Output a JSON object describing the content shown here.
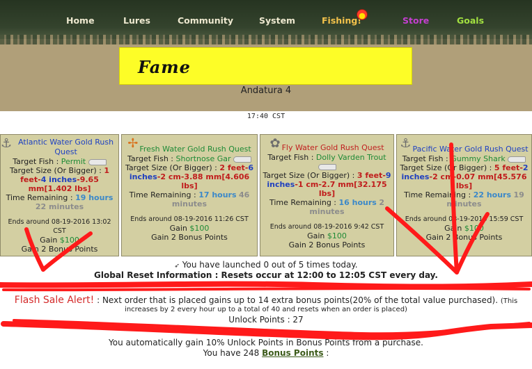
{
  "nav": {
    "home": "Home",
    "lures": "Lures",
    "community": "Community",
    "system": "System",
    "fishing": "Fishing!",
    "store": "Store",
    "goals": "Goals"
  },
  "banner": {
    "title": "Fame",
    "player": "Andatura 4"
  },
  "clock": "17:40 CST",
  "quests": [
    {
      "title": "Atlantic Water Gold Rush Quest",
      "fish_label": "Target Fish : ",
      "fish": "Permit",
      "size_label": "Target Size (Or Bigger) : ",
      "size_p1": "1 feet",
      "size_p2": "-",
      "size_p3": "4 inches",
      "size_p4": "-",
      "size_p5": "9.65 mm",
      "size_p6": "[1.402 lbs]",
      "time_label": "Time Remaining : ",
      "time_value": "19 hours",
      "time_extra": "22 minutes",
      "ends": "Ends around 08-19-2016 13:02 CST",
      "gain_label": "Gain ",
      "gain_value": "$100",
      "bonus": "Gain 2 Bonus Points"
    },
    {
      "title": "Fresh Water Gold Rush Quest",
      "fish_label": "Target Fish : ",
      "fish": "Shortnose Gar",
      "size_label": "Target Size (Or Bigger) : ",
      "size_p1": "2 feet",
      "size_p2": "-",
      "size_p3": "6 inches",
      "size_p4": "-",
      "size_p5": "2 cm-3.88 mm",
      "size_p6": "[4.606 lbs]",
      "time_label": "Time Remaining : ",
      "time_value": "17 hours",
      "time_extra": "46 minutes",
      "ends": "Ends around 08-19-2016 11:26 CST",
      "gain_label": "Gain ",
      "gain_value": "$100",
      "bonus": "Gain 2 Bonus Points"
    },
    {
      "title": "Fly Water Gold Rush Quest",
      "fish_label": "Target Fish : ",
      "fish": "Dolly Varden Trout",
      "size_label": "Target Size (Or Bigger) : ",
      "size_p1": "3 feet",
      "size_p2": "-",
      "size_p3": "9 inches",
      "size_p4": "-",
      "size_p5": "1 cm-2.7 mm",
      "size_p6": "[32.175 lbs]",
      "time_label": "Time Remaining : ",
      "time_value": "16 hours",
      "time_extra": "2 minutes",
      "ends": "Ends around 08-19-2016 9:42 CST",
      "gain_label": "Gain ",
      "gain_value": "$100",
      "bonus": "Gain 2 Bonus Points"
    },
    {
      "title": "Pacific Water Gold Rush Quest",
      "fish_label": "Target Fish : ",
      "fish": "Gummy Shark",
      "size_label": "Target Size (Or Bigger) : ",
      "size_p1": "5 feet",
      "size_p2": "-",
      "size_p3": "2 inches",
      "size_p4": "-",
      "size_p5": "2 cm-0.07 mm",
      "size_p6": "[45.576 lbs]",
      "time_label": "Time Remaining : ",
      "time_value": "22 hours",
      "time_extra": "19 minutes",
      "ends": "Ends around 08-19-2016 15:59 CST",
      "gain_label": "Gain ",
      "gain_value": "$100",
      "bonus": "Gain 2 Bonus Points"
    }
  ],
  "info": {
    "launch": "You have launched 0 out of 5 times today.",
    "reset": "Global Reset Information : Resets occur at 12:00 to 12:05 CST every day.",
    "flash_alert": "Flash Sale Alert!",
    "flash_text": " : Next order that is placed gains up to 14 extra bonus points(20% of the total value purchased).",
    "flash_note1": "(This",
    "flash_note2": "increases by 2 every hour up to a total of 40 and resets when an order is placed)",
    "unlock": "Unlock Points : 27",
    "auto": "You automatically gain 10% Unlock Points in Bonus Points from a purchase.",
    "have_prefix": "You have 248 ",
    "bonus_link": "Bonus Points",
    "have_suffix": " :"
  },
  "colors": {
    "scribble": "#ff1a1a",
    "banner": "#fdfd27",
    "card": "#d3cfa2"
  },
  "icons": {
    "bobber": "fishing-bobber-icon",
    "hook": "fishing-hook-icon",
    "fish": "fish-icon"
  }
}
